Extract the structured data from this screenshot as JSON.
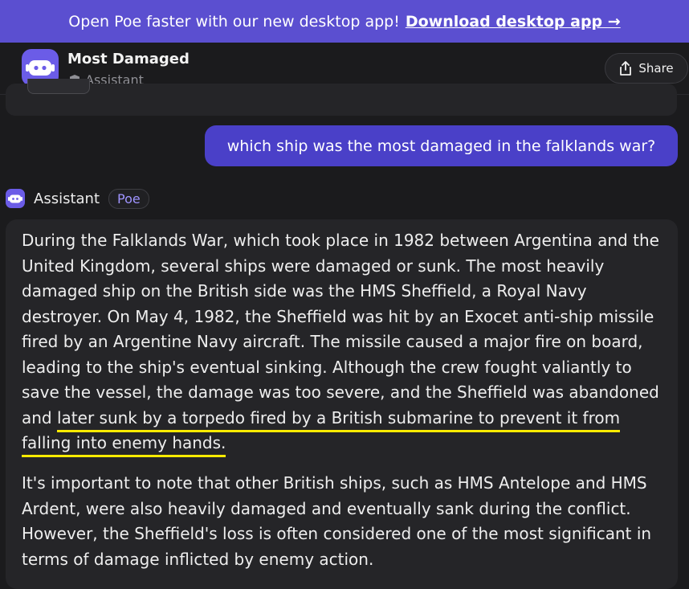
{
  "banner": {
    "text": "Open Poe faster with our new desktop app!",
    "link_label": "Download desktop app →"
  },
  "header": {
    "bot_name": "Most Damaged",
    "bot_subtitle": "Assistant",
    "share_label": "Share"
  },
  "conversation": {
    "user_message": "which ship was the most damaged in the falklands war?",
    "assistant_name": "Assistant",
    "assistant_badge": "Poe",
    "response": {
      "p1_part1": "During the Falklands War, which took place in 1982 between Argentina and the United Kingdom, several ships were damaged or sunk. The most heavily damaged ship on the British side was the HMS Sheffield, a Royal Navy destroyer. On May 4, 1982, the Sheffield was hit by an Exocet anti-ship missile fired by an Argentine Navy aircraft. The missile caused a major fire on board, leading to the ship's eventual sinking. Although the crew fought valiantly to save the vessel, the damage was too severe, and the Sheffield was abandoned and ",
      "p1_highlight": "later sunk by a torpedo fired by a British submarine to prevent it from falling into enemy hands.",
      "p2": "It's important to note that other British ships, such as HMS Antelope and HMS Ardent, were also heavily damaged and eventually sank during the conflict. However, the Sheffield's loss is often considered one of the most significant in terms of damage inflicted by enemy action."
    }
  },
  "icons": {
    "bot_avatar": "robot-icon",
    "verified": "shield-icon",
    "share": "share-icon"
  },
  "colors": {
    "banner": "#5b4fd0",
    "user_bubble": "#4a40c8",
    "highlight_underline": "#ffeb00",
    "badge_text": "#9f94ff"
  }
}
